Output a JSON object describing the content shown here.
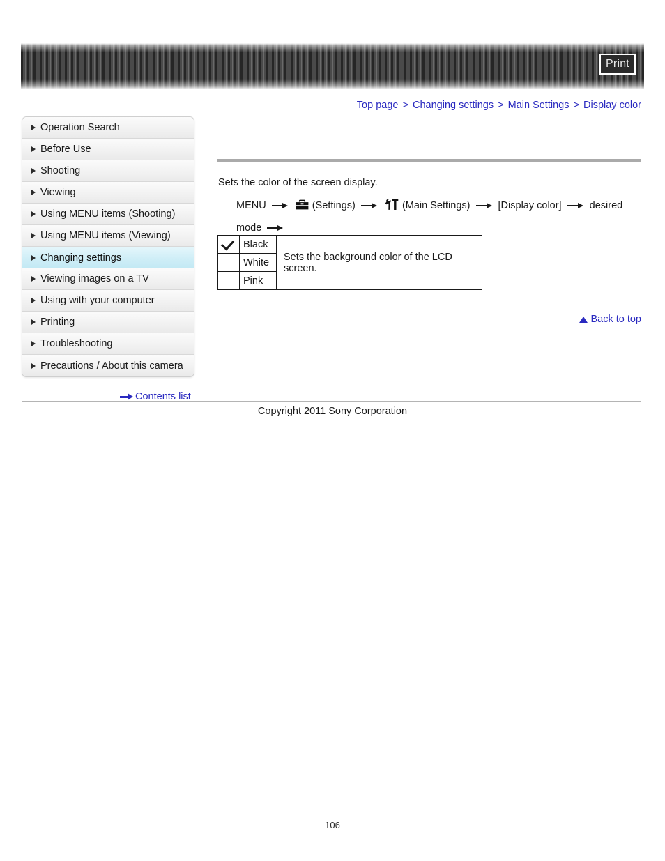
{
  "header": {
    "print_label": "Print"
  },
  "breadcrumb": {
    "separator": ">",
    "items": [
      {
        "label": "Top page"
      },
      {
        "label": "Changing settings"
      },
      {
        "label": "Main Settings"
      },
      {
        "label": "Display color"
      }
    ]
  },
  "sidebar": {
    "items": [
      {
        "label": "Operation Search",
        "active": false
      },
      {
        "label": "Before Use",
        "active": false
      },
      {
        "label": "Shooting",
        "active": false
      },
      {
        "label": "Viewing",
        "active": false
      },
      {
        "label": "Using MENU items (Shooting)",
        "active": false
      },
      {
        "label": "Using MENU items (Viewing)",
        "active": false
      },
      {
        "label": "Changing settings",
        "active": true
      },
      {
        "label": "Viewing images on a TV",
        "active": false
      },
      {
        "label": "Using with your computer",
        "active": false
      },
      {
        "label": "Printing",
        "active": false
      },
      {
        "label": "Troubleshooting",
        "active": false
      },
      {
        "label": "Precautions / About this camera",
        "active": false
      }
    ],
    "contents_list_label": "Contents list"
  },
  "main": {
    "intro": "Sets the color of the screen display.",
    "menu_path": {
      "menu_label": "MENU",
      "settings_label": "(Settings)",
      "main_settings_label": "(Main Settings)",
      "item_label": "[Display color]",
      "desired_mode_label": "desired mode"
    },
    "table": {
      "rows": [
        {
          "checked": true,
          "name": "Black"
        },
        {
          "checked": false,
          "name": "White"
        },
        {
          "checked": false,
          "name": "Pink"
        }
      ],
      "description": "Sets the background color of the LCD screen."
    },
    "back_to_top_label": "Back to top"
  },
  "footer": {
    "copyright": "Copyright 2011 Sony Corporation",
    "page_number": "106"
  },
  "colors": {
    "link": "#2a2ac0",
    "active_highlight": "#cfeef7",
    "banner": "#3a3a3a"
  }
}
